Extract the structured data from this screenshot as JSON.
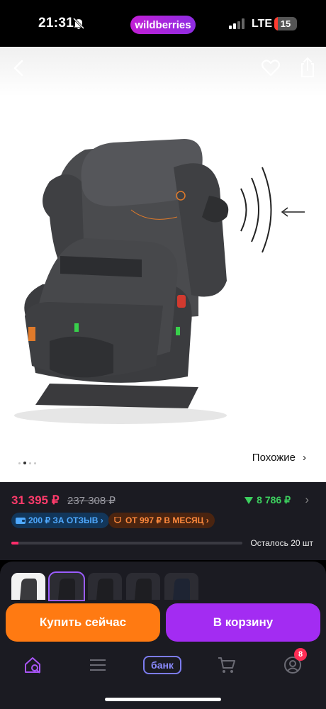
{
  "status_bar": {
    "time": "21:31",
    "brand": "wildberries",
    "network": "LTE",
    "battery": "15",
    "battery_level": 0.15,
    "battery_color": "#ff3b30"
  },
  "product_image": {
    "icons": [
      "back-icon",
      "heart-icon",
      "share-icon",
      "bell-off-icon",
      "signal-icon"
    ],
    "carousel": {
      "total": 4,
      "active_index": 1
    },
    "similar_label": "Похожие",
    "similar_chevron": "›"
  },
  "pricing": {
    "current_price": "31 395 ₽",
    "old_price": "237 308 ₽",
    "cashback": "8 786 ₽",
    "cashback_chevron": "›",
    "badge_review": "200 ₽ ЗА ОТЗЫВ ›",
    "badge_month": "ОТ 997 ₽ В МЕСЯЦ ›",
    "stock_text": "Осталось 20 шт",
    "stock_fraction": 0.03,
    "colors": {
      "price": "#ff3b6b",
      "cashback": "#3ccf5e",
      "review": "#4fa9ff",
      "month": "#ff8a3d"
    }
  },
  "variants": {
    "count": 5,
    "selected_index": 1
  },
  "actions": {
    "buy_now": "Купить сейчас",
    "add_to_cart": "В корзину",
    "colors": {
      "buy": "#ff7a12",
      "cart": "#a32cf2"
    }
  },
  "tabbar": {
    "items": [
      "home-search-icon",
      "catalog-menu-icon",
      "bank-tab",
      "cart-icon",
      "profile-icon"
    ],
    "bank_label": "банк",
    "profile_badge": "8"
  }
}
